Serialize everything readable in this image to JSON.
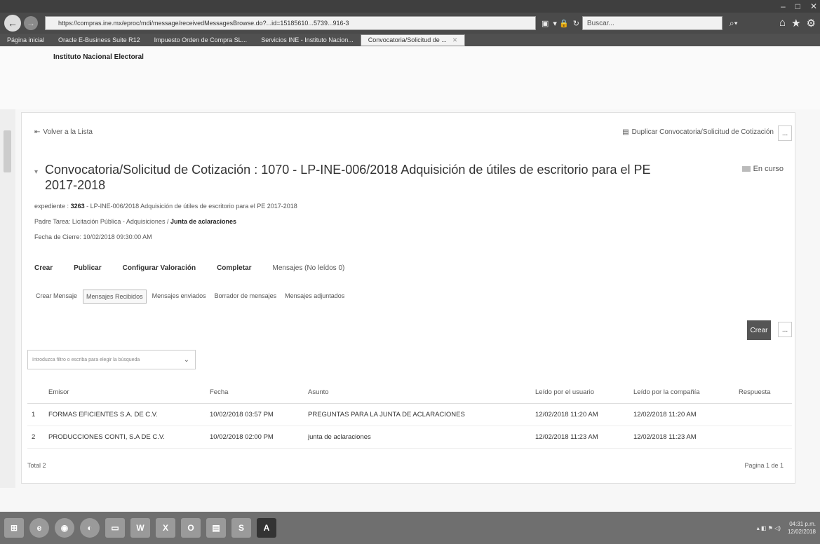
{
  "browser": {
    "url": "https://compras.ine.mx/eproc/mdi/message/receivedMessagesBrowse.do?...id=15185610...5739...916-3",
    "search_placeholder": "Buscar...",
    "tabs": [
      {
        "label": "Página inicial"
      },
      {
        "label": "Oracle E-Business Suite R12"
      },
      {
        "label": "Impuesto Orden de Compra SL..."
      },
      {
        "label": "Servicios INE - Instituto Nacion..."
      },
      {
        "label": "Convocatoria/Solicitud de ..."
      }
    ]
  },
  "header": {
    "org_name": "Instituto Nacional Electoral"
  },
  "page": {
    "back_label": "Volver a la Lista",
    "duplicate_label": "Duplicar Convocatoria/Solicitud de Cotización",
    "more_label": "...",
    "title": "Convocatoria/Solicitud de Cotización : 1070 - LP-INE-006/2018 Adquisición de útiles de escritorio para el PE 2017-2018",
    "status": "En curso",
    "expediente_label": "expediente :",
    "expediente_value": "3263",
    "expediente_desc": "- LP-INE-006/2018 Adquisición de útiles de escritorio para el PE 2017-2018",
    "padre_label": "Padre Tarea: Licitación Pública - Adquisiciones /",
    "padre_value": "Junta de aclaraciones",
    "cierre": "Fecha de Cierre: 10/02/2018 09:30:00 AM"
  },
  "menu": {
    "crear": "Crear",
    "publicar": "Publicar",
    "configurar": "Configurar Valoración",
    "completar": "Completar",
    "mensajes": "Mensajes (No leídos 0)"
  },
  "subtabs": {
    "crear_mensaje": "Crear Mensaje",
    "recibidos": "Mensajes Recibidos",
    "enviados": "Mensajes enviados",
    "borrador": "Borrador de mensajes",
    "adjuntados": "Mensajes adjuntados"
  },
  "actions": {
    "create_label": "Crear",
    "more_label": "..."
  },
  "filter": {
    "placeholder": "Introduzca filtro o escriba para elegir la búsqueda"
  },
  "table": {
    "headers": {
      "emisor": "Emisor",
      "fecha": "Fecha",
      "asunto": "Asunto",
      "leido_usuario": "Leído por el usuario",
      "leido_compania": "Leído por la compañía",
      "respuesta": "Respuesta"
    },
    "rows": [
      {
        "num": "1",
        "emisor": "FORMAS EFICIENTES S.A. DE C.V.",
        "fecha": "10/02/2018 03:57 PM",
        "asunto": "PREGUNTAS PARA LA JUNTA DE ACLARACIONES",
        "leido_usuario": "12/02/2018 11:20 AM",
        "leido_compania": "12/02/2018 11:20 AM",
        "respuesta": ""
      },
      {
        "num": "2",
        "emisor": "PRODUCCIONES CONTI, S.A DE C.V.",
        "fecha": "10/02/2018 02:00 PM",
        "asunto": "junta de aclaraciones",
        "leido_usuario": "12/02/2018 11:23 AM",
        "leido_compania": "12/02/2018 11:23 AM",
        "respuesta": ""
      }
    ],
    "total": "Total 2",
    "pager": "Pagina 1 de 1"
  },
  "taskbar": {
    "time": "04:31 p.m.",
    "date": "12/02/2018"
  }
}
